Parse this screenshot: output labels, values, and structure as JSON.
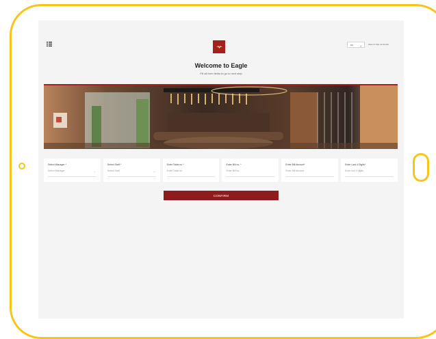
{
  "header": {
    "menu_icon": "menu-icon",
    "logo_icon": "brand-logo-icon",
    "language": {
      "selected": "EN",
      "chevron": "⌄"
    },
    "datetime": "Wed 17 Mar 11:30 AM"
  },
  "welcome": {
    "title": "Welcome to Eagle",
    "subtitle": "Fill all form fields to go to next step"
  },
  "form": {
    "manager": {
      "label": "Select Manager *",
      "placeholder": "Select Manager",
      "chevron": "⌄"
    },
    "staff": {
      "label": "Select Staff *",
      "placeholder": "Select Staff",
      "chevron": "⌄"
    },
    "table": {
      "label": "Enter Table no *",
      "placeholder": "Enter Table no"
    },
    "bill_no": {
      "label": "Enter Bill no. *",
      "placeholder": "Enter Bill no."
    },
    "bill_amount": {
      "label": "Enter Bill Amount*",
      "placeholder": "Enter Bill Amount"
    },
    "last_four": {
      "label": "Enter Last 4 Digits*",
      "placeholder": "Enter last 4 digits"
    }
  },
  "confirm_label": "CONFIRM",
  "colors": {
    "accent": "#8e1c1c",
    "device_frame": "#f5c518",
    "screen_bg": "#f4f4f4"
  }
}
